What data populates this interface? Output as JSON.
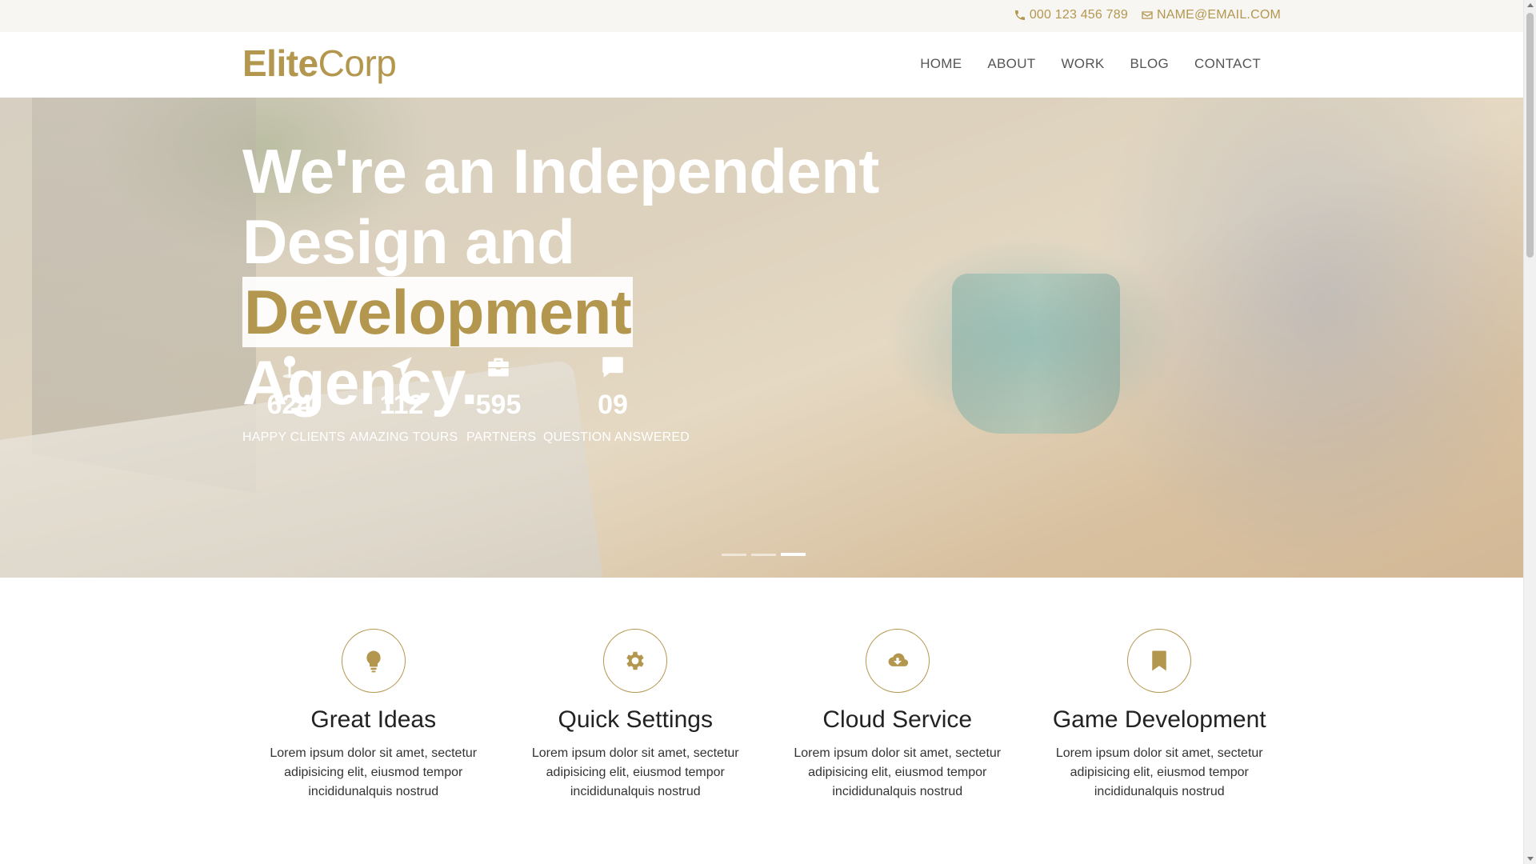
{
  "topbar": {
    "phone": "000 123 456 789",
    "email": "NAME@EMAIL.COM",
    "phone_icon": "phone-icon",
    "email_icon": "envelope-icon"
  },
  "header": {
    "logo_bold": "Elite",
    "logo_light": "Corp",
    "nav": [
      "HOME",
      "ABOUT",
      "WORK",
      "BLOG",
      "CONTACT"
    ]
  },
  "hero": {
    "line1": "We're an Independent",
    "line2_pre": "Design and ",
    "line2_highlight": "Development",
    "line3": "Agency.",
    "stats": [
      {
        "icon": "map-pin-icon",
        "value": "624",
        "label": "HAPPY CLIENTS"
      },
      {
        "icon": "location-arrow-icon",
        "value": "112",
        "label": "AMAZING TOURS"
      },
      {
        "icon": "briefcase-icon",
        "value": "595",
        "label": "PARTNERS"
      },
      {
        "icon": "speech-bubble-icon",
        "value": "09",
        "label": "QUESTION ANSWERED"
      }
    ],
    "slider_active_index": 3,
    "slider_count": 3
  },
  "features": [
    {
      "icon": "lightbulb-icon",
      "title": "Great Ideas",
      "text": "Lorem ipsum dolor sit amet, sectetur adipisicing elit, eiusmod tempor incididunalquis nostrud"
    },
    {
      "icon": "gear-icon",
      "title": "Quick Settings",
      "text": "Lorem ipsum dolor sit amet, sectetur adipisicing elit, eiusmod tempor incididunalquis nostrud"
    },
    {
      "icon": "cloud-download-icon",
      "title": "Cloud Service",
      "text": "Lorem ipsum dolor sit amet, sectetur adipisicing elit, eiusmod tempor incididunalquis nostrud"
    },
    {
      "icon": "bookmark-icon",
      "title": "Game Development",
      "text": "Lorem ipsum dolor sit amet, sectetur adipisicing elit, eiusmod tempor incididunalquis nostrud"
    }
  ],
  "colors": {
    "accent": "#b4974f",
    "topbar_bg": "#f7f6f3"
  }
}
